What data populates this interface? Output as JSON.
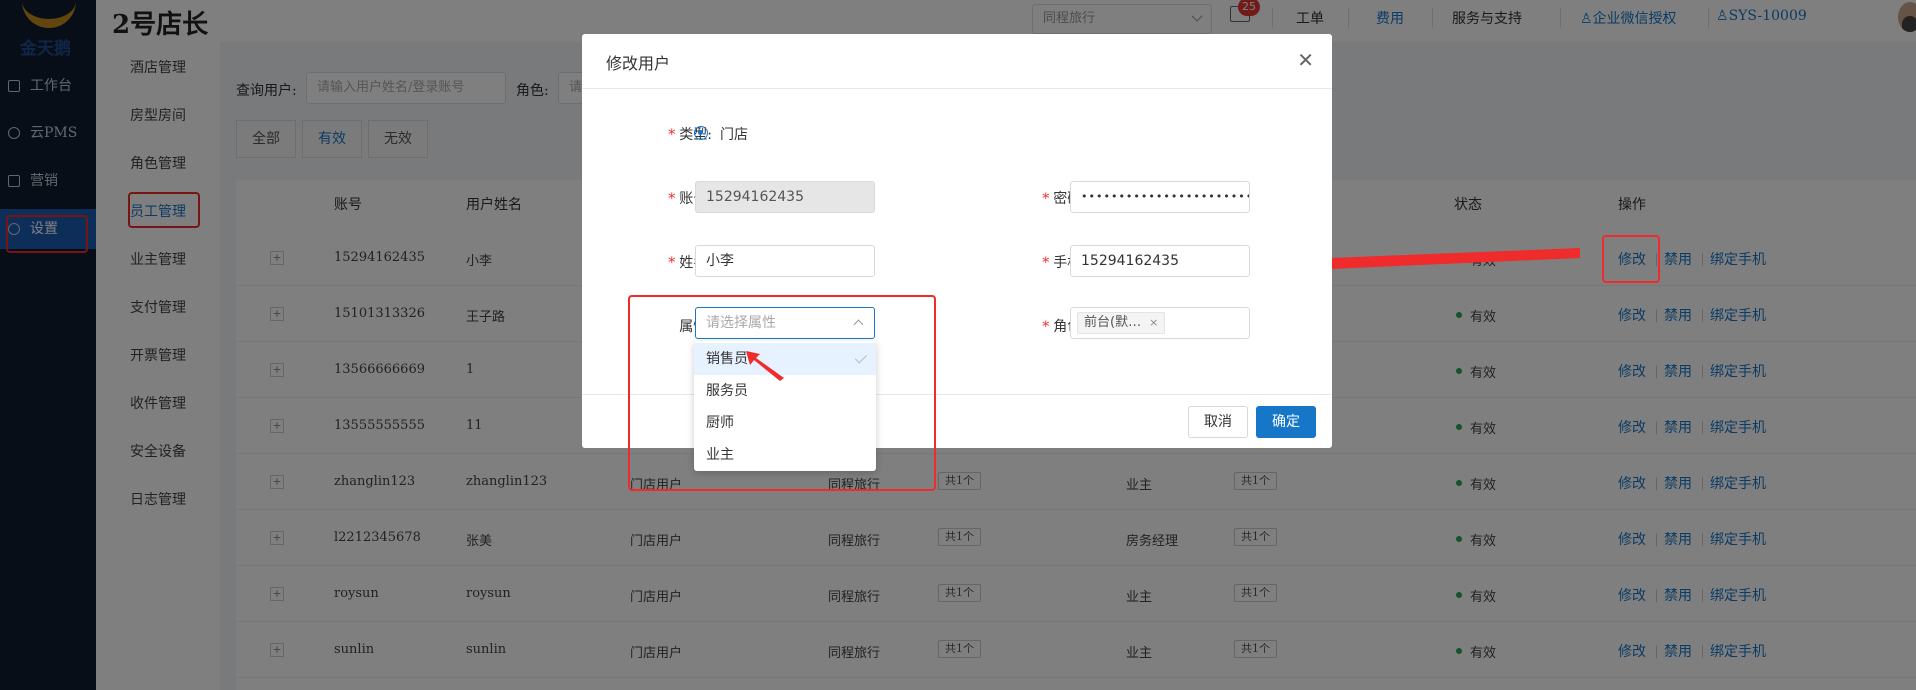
{
  "app": {
    "title": "2号店长",
    "logo_text": "金天鹅"
  },
  "sidebar": {
    "items": [
      {
        "label": "工作台"
      },
      {
        "label": "云PMS"
      },
      {
        "label": "营销"
      },
      {
        "label": "设置"
      }
    ]
  },
  "subnav": {
    "items": [
      {
        "label": "酒店管理"
      },
      {
        "label": "房型房间"
      },
      {
        "label": "角色管理"
      },
      {
        "label": "员工管理"
      },
      {
        "label": "业主管理"
      },
      {
        "label": "支付管理"
      },
      {
        "label": "开票管理"
      },
      {
        "label": "收件管理"
      },
      {
        "label": "安全设备"
      },
      {
        "label": "日志管理"
      }
    ]
  },
  "topbar": {
    "hotel_select": "同程旅行",
    "mail_count": "25",
    "links": [
      "工单",
      "费用",
      "服务与支持",
      "企业微信授权",
      "SYS-10009"
    ]
  },
  "filters": {
    "user_label": "查询用户:",
    "user_placeholder": "请输入用户姓名/登录账号",
    "role_label": "角色:",
    "role_placeholder": "请"
  },
  "tabs": [
    "全部",
    "有效",
    "无效"
  ],
  "table": {
    "headers": {
      "account": "账号",
      "name": "用户姓名",
      "status": "状态",
      "actions": "操作"
    },
    "actions": {
      "edit": "修改",
      "disable": "禁用",
      "bind": "绑定手机"
    },
    "rows": [
      {
        "account": "15294162435",
        "name": "小李",
        "type": "",
        "hotel": "",
        "count1": "",
        "role": "",
        "count2": "",
        "status": "有效"
      },
      {
        "account": "15101313326",
        "name": "王子路",
        "type": "",
        "hotel": "",
        "count1": "",
        "role": "",
        "count2": "",
        "status": "有效"
      },
      {
        "account": "13566666669",
        "name": "1",
        "type": "",
        "hotel": "",
        "count1": "",
        "role": "",
        "count2": "",
        "status": "有效"
      },
      {
        "account": "13555555555",
        "name": "11",
        "type": "",
        "hotel": "",
        "count1": "",
        "role": "",
        "count2": "",
        "status": "有效"
      },
      {
        "account": "zhanglin123",
        "name": "zhanglin123",
        "type": "门店用户",
        "hotel": "同程旅行",
        "count1": "共1个",
        "role": "业主",
        "count2": "共1个",
        "status": "有效"
      },
      {
        "account": "l2212345678",
        "name": "张美",
        "type": "门店用户",
        "hotel": "同程旅行",
        "count1": "共1个",
        "role": "房务经理",
        "count2": "共1个",
        "status": "有效"
      },
      {
        "account": "roysun",
        "name": "roysun",
        "type": "门店用户",
        "hotel": "同程旅行",
        "count1": "共1个",
        "role": "业主",
        "count2": "共1个",
        "status": "有效"
      },
      {
        "account": "sunlin",
        "name": "sunlin",
        "type": "门店用户",
        "hotel": "同程旅行",
        "count1": "共1个",
        "role": "业主",
        "count2": "共1个",
        "status": "有效"
      }
    ]
  },
  "modal": {
    "title": "修改用户",
    "type_label": "类型:",
    "type_value": "门店",
    "account_label": "账号:",
    "account_value": "15294162435",
    "password_label": "密码:",
    "password_value": "•••••••••••••••••••••••",
    "name_label": "姓名:",
    "name_value": "小李",
    "phone_label": "手机:",
    "phone_value": "15294162435",
    "attr_label": "属性:",
    "attr_placeholder": "请选择属性",
    "role_label": "角色:",
    "role_tag": "前台(默…",
    "cancel": "取消",
    "confirm": "确定"
  },
  "dropdown": {
    "options": [
      "销售员",
      "服务员",
      "厨师",
      "业主"
    ]
  },
  "colors": {
    "accent": "#1677c9",
    "annotation": "#ef2b2b",
    "sidebar": "#0f1c2e"
  }
}
